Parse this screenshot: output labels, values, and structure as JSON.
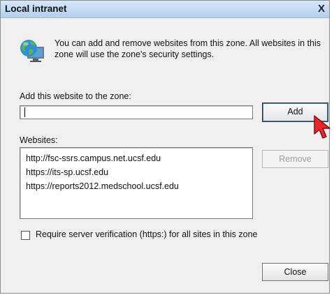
{
  "window": {
    "title": "Local intranet",
    "close_glyph": "X"
  },
  "intro": {
    "icon": "globe-computer-icon",
    "text": "You can add and remove websites from this zone. All websites in this zone will use the zone's security settings."
  },
  "add_section": {
    "label": "Add this website to the zone:",
    "input_value": "",
    "add_label": "Add"
  },
  "websites": {
    "label": "Websites:",
    "items": [
      "http://fsc-ssrs.campus.net.ucsf.edu",
      "https://its-sp.ucsf.edu",
      "https://reports2012.medschool.ucsf.edu"
    ],
    "remove_label": "Remove"
  },
  "verification": {
    "label": "Require server verification (https:) for all sites in this zone",
    "checked": false
  },
  "footer": {
    "close_label": "Close"
  },
  "colors": {
    "titlebar": "#c3d9f4",
    "dialog_bg": "#f0f0f0",
    "cursor": "#e8262b"
  }
}
